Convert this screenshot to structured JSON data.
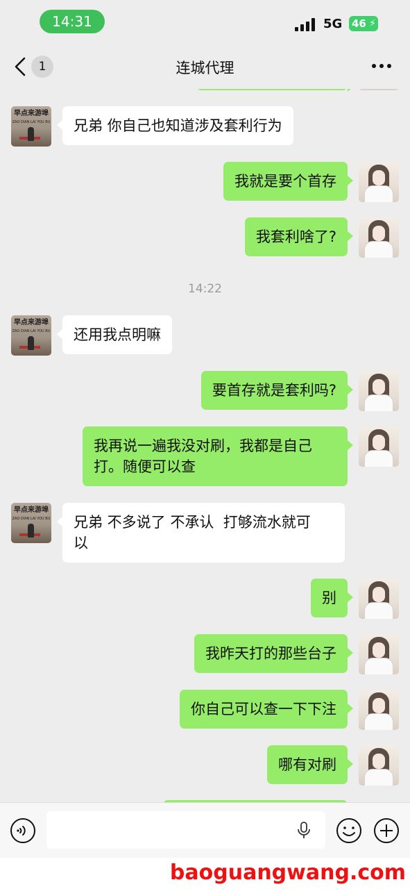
{
  "status_bar": {
    "time": "14:31",
    "network": "5G",
    "battery": "46"
  },
  "nav": {
    "unread_count": "1",
    "title": "连城代理"
  },
  "messages": [
    {
      "side": "left",
      "text": "兄弟 你自己也知道涉及套利行为"
    },
    {
      "side": "right",
      "text": "我就是要个首存"
    },
    {
      "side": "right",
      "text": "我套利啥了?"
    },
    {
      "timestamp": "14:22"
    },
    {
      "side": "left",
      "text": "还用我点明嘛"
    },
    {
      "side": "right",
      "text": "要首存就是套利吗?"
    },
    {
      "side": "right",
      "text": "我再说一遍我没对刷，我都是自己\n打。随便可以查"
    },
    {
      "side": "left",
      "text": "兄弟 不多说了 不承认  打够流水就可\n以"
    },
    {
      "side": "right",
      "text": "别"
    },
    {
      "side": "right",
      "text": "我昨天打的那些台子"
    },
    {
      "side": "right",
      "text": "你自己可以查一下下注"
    },
    {
      "side": "right",
      "text": "哪有对刷"
    }
  ],
  "contact_avatar_sign": "早点来游埠",
  "contact_avatar_sign_sub": "ZAO DIAN LAI YOU BU",
  "input": {
    "value": ""
  },
  "icons": {
    "back": "chevron-left-icon",
    "more": "more-dots-icon",
    "voice": "voice-icon",
    "mic": "mic-icon",
    "emoji": "emoji-icon",
    "plus": "plus-icon"
  },
  "colors": {
    "sent_bubble": "#95ec69",
    "received_bubble": "#ffffff",
    "background": "#ededed",
    "time_pill": "#3fbf5a"
  },
  "watermark": "baoguangwang.com"
}
